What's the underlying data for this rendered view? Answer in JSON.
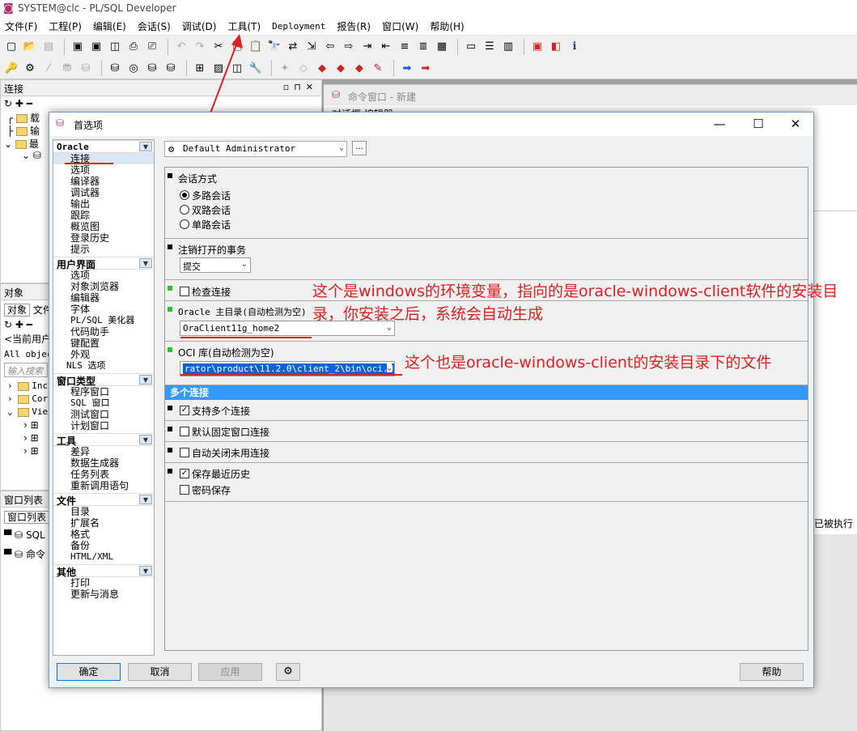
{
  "app": {
    "title": "SYSTEM@clc - PL/SQL Developer",
    "menu": [
      "文件(F)",
      "工程(P)",
      "编辑(E)",
      "会话(S)",
      "调试(D)",
      "工具(T)",
      "Deployment",
      "报告(R)",
      "窗口(W)",
      "帮助(H)"
    ]
  },
  "left_panels": {
    "connections": {
      "title": "连接",
      "items": [
        "载",
        "输",
        "最"
      ]
    },
    "objects": {
      "title": "对象",
      "tabs": [
        "对象",
        "文件"
      ],
      "current_user": "<当前用户",
      "filter": "All objec",
      "search_placeholder": "输入搜索",
      "tree": [
        "Inc",
        "Cor",
        "Vie"
      ]
    },
    "window_list": {
      "title": "窗口列表",
      "tab": "窗口列表",
      "items": [
        "SQL",
        "命令"
      ]
    }
  },
  "right_area": {
    "tab_title": "命令窗口 - 新建",
    "tabs": [
      "对话框",
      "编辑器"
    ],
    "status_fragment": "已被执行"
  },
  "dialog": {
    "title": "首选项",
    "categories": [
      {
        "header": "Oracle",
        "items": [
          "连接",
          "选项",
          "编译器",
          "调试器",
          "输出",
          "跟踪",
          "概览图",
          "登录历史",
          "提示"
        ]
      },
      {
        "header": "用户界面",
        "items": [
          "选项",
          "对象浏览器",
          "编辑器",
          "字体",
          "PL/SQL 美化器",
          "代码助手",
          "键配置",
          "外观",
          "NLS 选项"
        ]
      },
      {
        "header": "窗口类型",
        "items": [
          "程序窗口",
          "SQL 窗口",
          "测试窗口",
          "计划窗口"
        ]
      },
      {
        "header": "工具",
        "items": [
          "差异",
          "数据生成器",
          "任务列表",
          "重新调用语句"
        ]
      },
      {
        "header": "文件",
        "items": [
          "目录",
          "扩展名",
          "格式",
          "备份",
          "HTML/XML"
        ]
      },
      {
        "header": "其他",
        "items": [
          "打印",
          "更新与消息"
        ]
      }
    ],
    "selected_category": "连接",
    "profile": "Default Administrator",
    "profile_more": "...",
    "session_mode": {
      "title": "会话方式",
      "options": [
        "多路会话",
        "双路会话",
        "单路会话"
      ],
      "selected": "多路会话"
    },
    "logoff": {
      "title": "注销打开的事务",
      "value": "提交"
    },
    "check_connection": {
      "label": "检查连接",
      "checked": false
    },
    "oracle_home": {
      "title": "Oracle 主目录(自动检测为空)",
      "value": "OraClient11g_home2"
    },
    "oci_library": {
      "title": "OCI 库(自动检测为空)",
      "value": "rator\\product\\11.2.0\\client_2\\bin\\oci.dll"
    },
    "multi_connection": {
      "title": "多个连接",
      "options": [
        {
          "label": "支持多个连接",
          "checked": true
        },
        {
          "label": "默认固定窗口连接",
          "checked": false
        },
        {
          "label": "自动关闭未用连接",
          "checked": false
        },
        {
          "label": "保存最近历史",
          "checked": true
        },
        {
          "label": "密码保存",
          "checked": false
        }
      ]
    },
    "buttons": {
      "ok": "确定",
      "cancel": "取消",
      "apply": "应用",
      "help": "帮助"
    }
  },
  "annotations": {
    "oracle_home_note": "这个是windows的环境变量，指向的是oracle-windows-client软件的安装目录，你安装之后，系统会自动生成",
    "oci_note": "这个也是oracle-windows-client的安装目录下的文件"
  },
  "colors": {
    "annotation": "#e02020",
    "section_bar": "#3399ff",
    "marker_green": "#28c428"
  }
}
